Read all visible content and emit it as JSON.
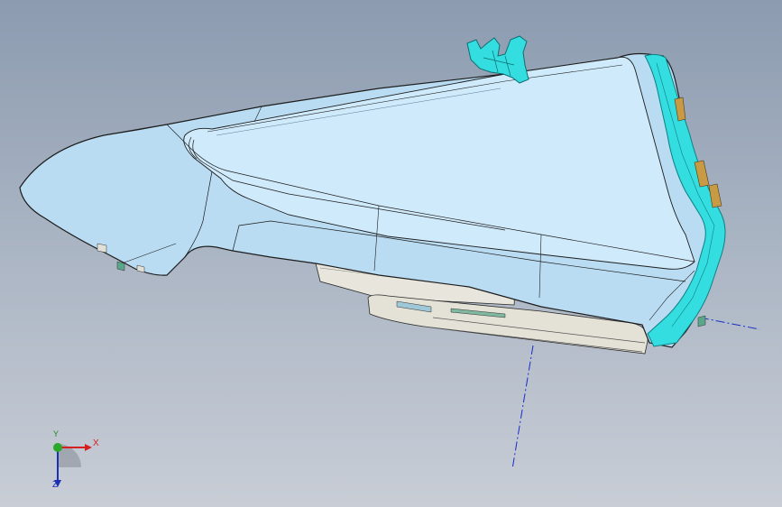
{
  "viewport": {
    "background_top": "#8c9bb0",
    "background_bottom": "#c8cdd6"
  },
  "model": {
    "body_fill": "#b9dcf2",
    "body_fill_light": "#cfeafb",
    "edge_color": "#1d1d1d",
    "highlight_color": "#33dde0",
    "accent_color": "#c89a44",
    "lower_part_fill": "#e4e1d6"
  },
  "axis_line_color": "#1a2ec8",
  "triad": {
    "x_label": "X",
    "y_label": "Y",
    "z_label": "Z",
    "x_color": "#d62020",
    "y_color": "#1a8a1a",
    "z_color": "#1b2fb5"
  }
}
